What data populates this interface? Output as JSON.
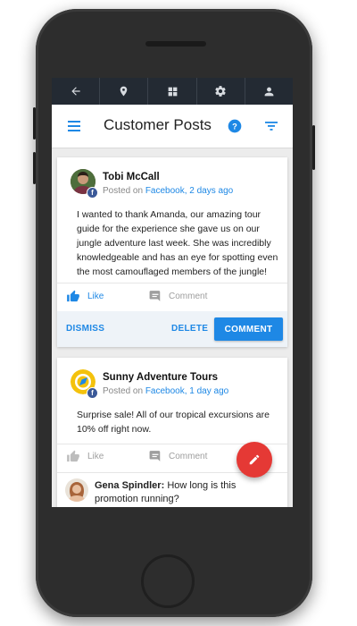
{
  "system_nav": {
    "items": [
      {
        "icon": "back-arrow-icon"
      },
      {
        "icon": "location-pin-icon"
      },
      {
        "icon": "dashboard-grid-icon"
      },
      {
        "icon": "gear-icon"
      },
      {
        "icon": "person-icon"
      }
    ]
  },
  "appbar": {
    "title": "Customer Posts",
    "icons": [
      "menu-icon",
      "help-icon",
      "filter-icon"
    ],
    "accent": "#1e88e5"
  },
  "posts": [
    {
      "author": "Tobi McCall",
      "meta_prefix": "Posted on ",
      "source": "Facebook, 2 days ago",
      "text": "I wanted to thank Amanda, our amazing tour guide for the experience she gave us on our jungle adventure last week. She was incredibly knowledgeable and has an eye for spotting even the most camouflaged members of the jungle!",
      "like_label": "Like",
      "comment_label": "Comment",
      "dismiss_label": "DISMISS",
      "delete_label": "DELETE",
      "comment_button_label": "COMMENT"
    },
    {
      "author": "Sunny Adventure Tours",
      "meta_prefix": "Posted on ",
      "source": "Facebook, 1 day ago",
      "text": "Surprise sale! All of our tropical excursions are 10% off right now.",
      "like_label": "Like",
      "comment_label": "Comment"
    }
  ],
  "reply": {
    "author": "Gena Spindler:",
    "text": "How long is this promotion running?"
  },
  "fab": {
    "icon": "pencil-icon",
    "color": "#e53935"
  }
}
